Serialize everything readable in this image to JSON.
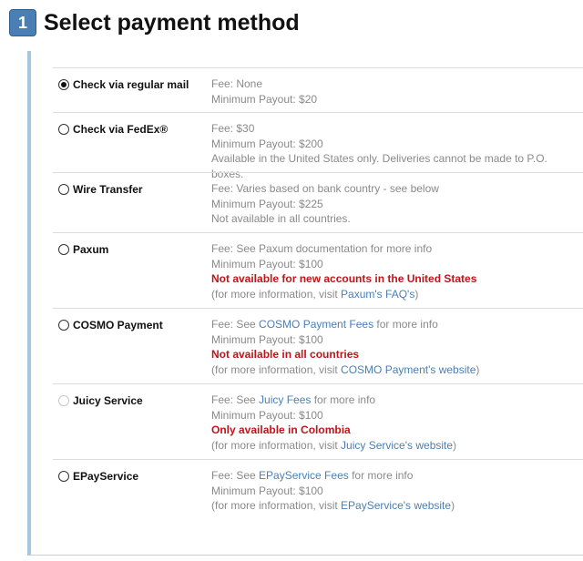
{
  "header": {
    "step": "1",
    "title": "Select payment method"
  },
  "methods": [
    {
      "label": "Check via regular mail",
      "fee": "Fee: None",
      "min": "Minimum Payout: $20"
    },
    {
      "label": "Check via FedEx®",
      "fee": "Fee: $30",
      "min": "Minimum Payout: $200",
      "note": "Available in the United States only. Deliveries cannot be made to P.O. boxes."
    },
    {
      "label": "Wire Transfer",
      "fee": "Fee: Varies based on bank country - see below",
      "min": "Minimum Payout: $225",
      "note": "Not available in all countries."
    },
    {
      "label": "Paxum",
      "fee": "Fee: See Paxum documentation for more info",
      "min": "Minimum Payout: $100",
      "warn": "Not available for new accounts in the United States",
      "more_pre": "(for more information, visit ",
      "more_link": "Paxum's FAQ's",
      "more_post": ")"
    },
    {
      "label": "COSMO Payment",
      "fee_pre": "Fee: See ",
      "fee_link": "COSMO Payment Fees",
      "fee_post": " for more info",
      "min": "Minimum Payout: $100",
      "warn": "Not available in all countries",
      "more_pre": "(for more information, visit ",
      "more_link": "COSMO Payment's website",
      "more_post": ")"
    },
    {
      "label": "Juicy Service",
      "fee_pre": "Fee: See ",
      "fee_link": "Juicy Fees",
      "fee_post": " for more info",
      "min": "Minimum Payout: $100",
      "warn": "Only available in Colombia",
      "more_pre": "(for more information, visit ",
      "more_link": "Juicy Service's website",
      "more_post": ")"
    },
    {
      "label": "EPayService",
      "fee_pre": "Fee: See ",
      "fee_link": "EPayService Fees",
      "fee_post": " for more info",
      "min": "Minimum Payout: $100",
      "more_pre": "(for more information, visit ",
      "more_link": "EPayService's website",
      "more_post": ")"
    }
  ],
  "selected_index": 0,
  "colors": {
    "accent": "#4a7fb5",
    "warning": "#c0141b",
    "muted": "#8a8a8a",
    "panel_border": "#a6c6dc"
  }
}
